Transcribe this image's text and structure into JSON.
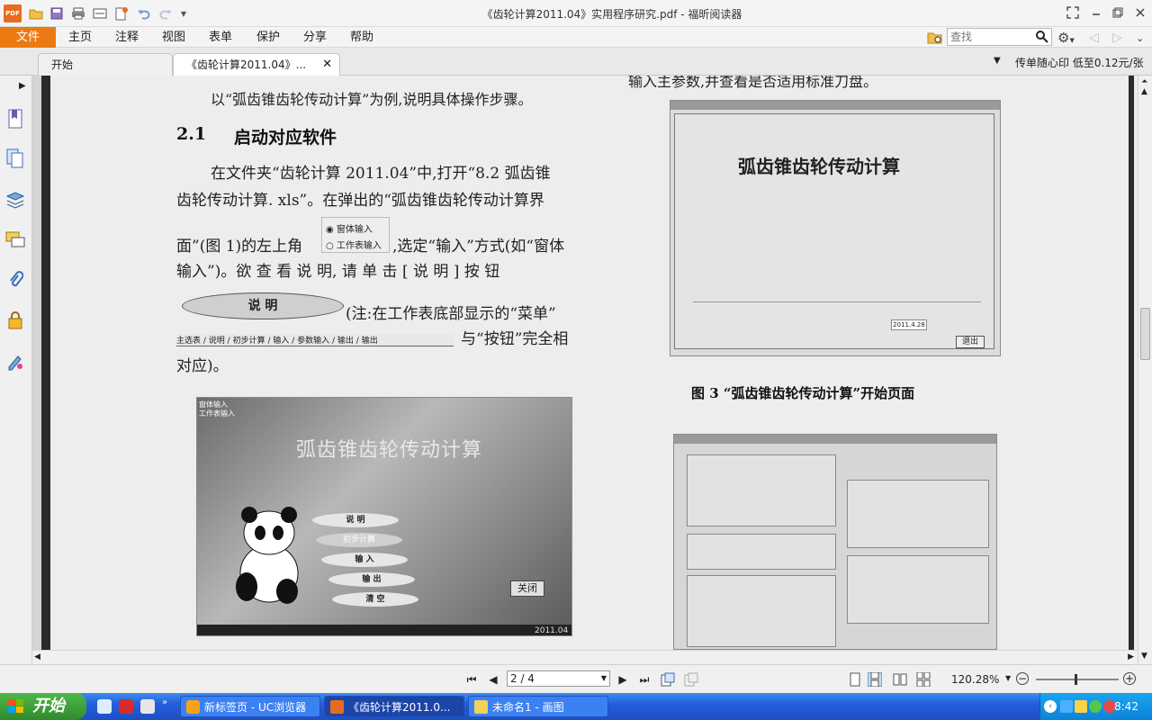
{
  "app": {
    "logo": "PDF",
    "window_title": "《齿轮计算2011.04》实用程序研究.pdf - 福昕阅读器"
  },
  "menu": {
    "items": [
      "文件",
      "主页",
      "注释",
      "视图",
      "表单",
      "保护",
      "分享",
      "帮助"
    ]
  },
  "search": {
    "placeholder": "查找"
  },
  "tabs": [
    {
      "label": "开始"
    },
    {
      "label": "《齿轮计算2011.04》..."
    }
  ],
  "promo": "传单随心印 低至0.12元/张",
  "document": {
    "top_line": "以“弧齿锥齿轮传动计算”为例,说明具体操作步骤。",
    "heading_num": "2.1",
    "heading": "启动对应软件",
    "para1": [
      "在文件夹“齿轮计算 2011.04”中,打开“8.2 弧齿锥",
      "齿轮传动计算. xls”。在弹出的“弧齿锥齿轮传动计算界",
      "面”(图 1)的左上角",
      ",选定“输入”方式(如“窗体",
      "输入”)。欲 查 看 说 明, 请 单 击 [ 说 明 ] 按 钮",
      "(注:在工作表底部显示的“菜单”",
      "与“按钮”完全相",
      "对应)。"
    ],
    "radio_a": "窗体输入",
    "radio_b": "工作表输入",
    "oval_btn": "说    明",
    "sheet_tabs": [
      "主选表",
      "说明",
      "初步计算",
      "输入",
      "参数输入",
      "输出",
      "输出"
    ],
    "right_top": "输入主参数,并查看是否适用标准刀盘。",
    "fig3_caption": "图 3  “弧齿锥齿轮传动计算”开始页面",
    "fig1_title": "弧齿锥齿轮传动计算",
    "fig1_radio_a": "窗体输入",
    "fig1_radio_b": "工作表输入",
    "fig1_buttons": [
      "说    明",
      "初步计算",
      "输    入",
      "输    出",
      "清    空"
    ],
    "fig1_close": "关闭",
    "fig1_version": "2011.04",
    "fig3_title": "弧齿锥齿轮传动计算",
    "fig3_back": "退出",
    "fig3_date": "2011.4.28"
  },
  "statusbar": {
    "page_display": "2 / 4",
    "zoom": "120.28%",
    "zoom_level_fraction": 0.48
  },
  "taskbar": {
    "start": "开始",
    "tasks": [
      {
        "label": "新标签页 - UC浏览器"
      },
      {
        "label": "《齿轮计算2011.0..."
      },
      {
        "label": "未命名1 - 画图"
      }
    ],
    "clock": "8:42"
  }
}
